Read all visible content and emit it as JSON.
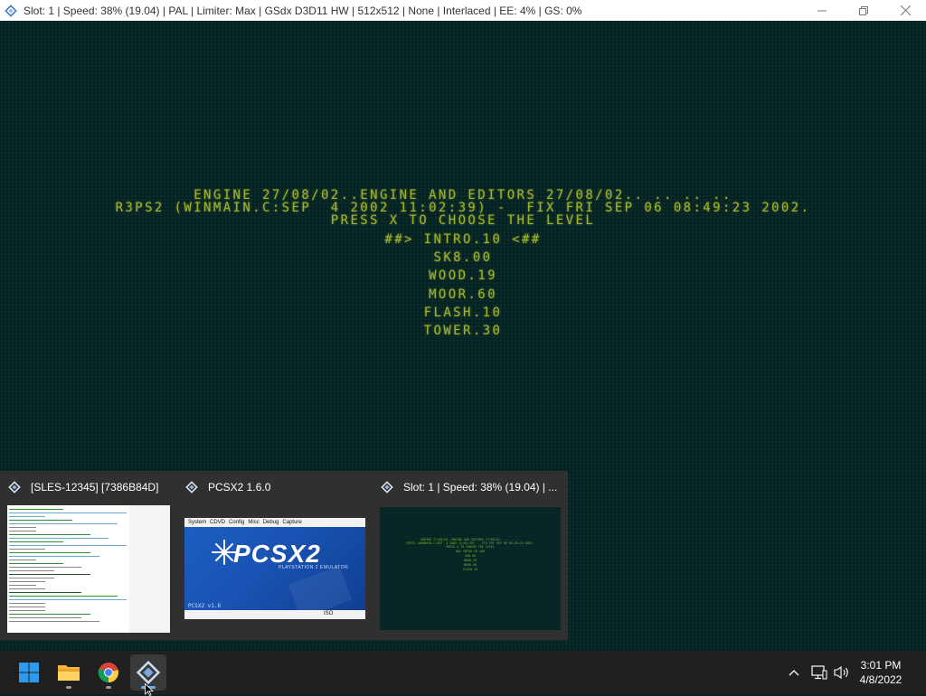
{
  "window": {
    "title": "Slot: 1 | Speed:  38% (19.04) | PAL | Limiter: Max | GSdx D3D11 HW | 512x512 | None | Interlaced | EE:   4% | GS:   0%",
    "controls": [
      "minimize-icon",
      "restore-icon",
      "close-icon"
    ]
  },
  "game": {
    "line1": "ENGINE 27/08/02..ENGINE AND EDITORS 27/08/02.. .. .. ..",
    "line2": "R3PS2 (WINMAIN.C:SEP  4 2002 11:02:39) -  FIX FRI SEP 06 08:49:23 2002.",
    "line3": "PRESS X TO CHOOSE THE LEVEL",
    "selected_level": "##> INTRO.10 <##",
    "levels": [
      "SK8.00",
      "WOOD.19",
      "MOOR.60",
      "FLASH.10",
      "TOWER.30"
    ]
  },
  "thumbnails": [
    {
      "title": "[SLES-12345] [7386B84D]"
    },
    {
      "title": "PCSX2  1.6.0",
      "menu": [
        "System",
        "CDVD",
        "Config",
        "Misc",
        "Debug",
        "Capture"
      ],
      "logo": "PCSX2",
      "subtitle": "PLAYSTATION 2 EMULATOR",
      "version": "PCSX2 v1.6",
      "status": "ISO"
    },
    {
      "title": "Slot: 1 | Speed:  38% (19.04) | ..."
    }
  ],
  "taskbar": {
    "apps": [
      "start-icon",
      "file-explorer-icon",
      "chrome-icon",
      "pcsx2-icon"
    ],
    "tray": [
      "chevron-up-icon",
      "network-icon",
      "volume-icon"
    ],
    "time": "3:01 PM",
    "date": "4/8/2022"
  },
  "colors": {
    "game_text": "#9fb02c",
    "game_bg": "#062323",
    "taskbar": "#202020",
    "thumb_panel": "#303030"
  }
}
